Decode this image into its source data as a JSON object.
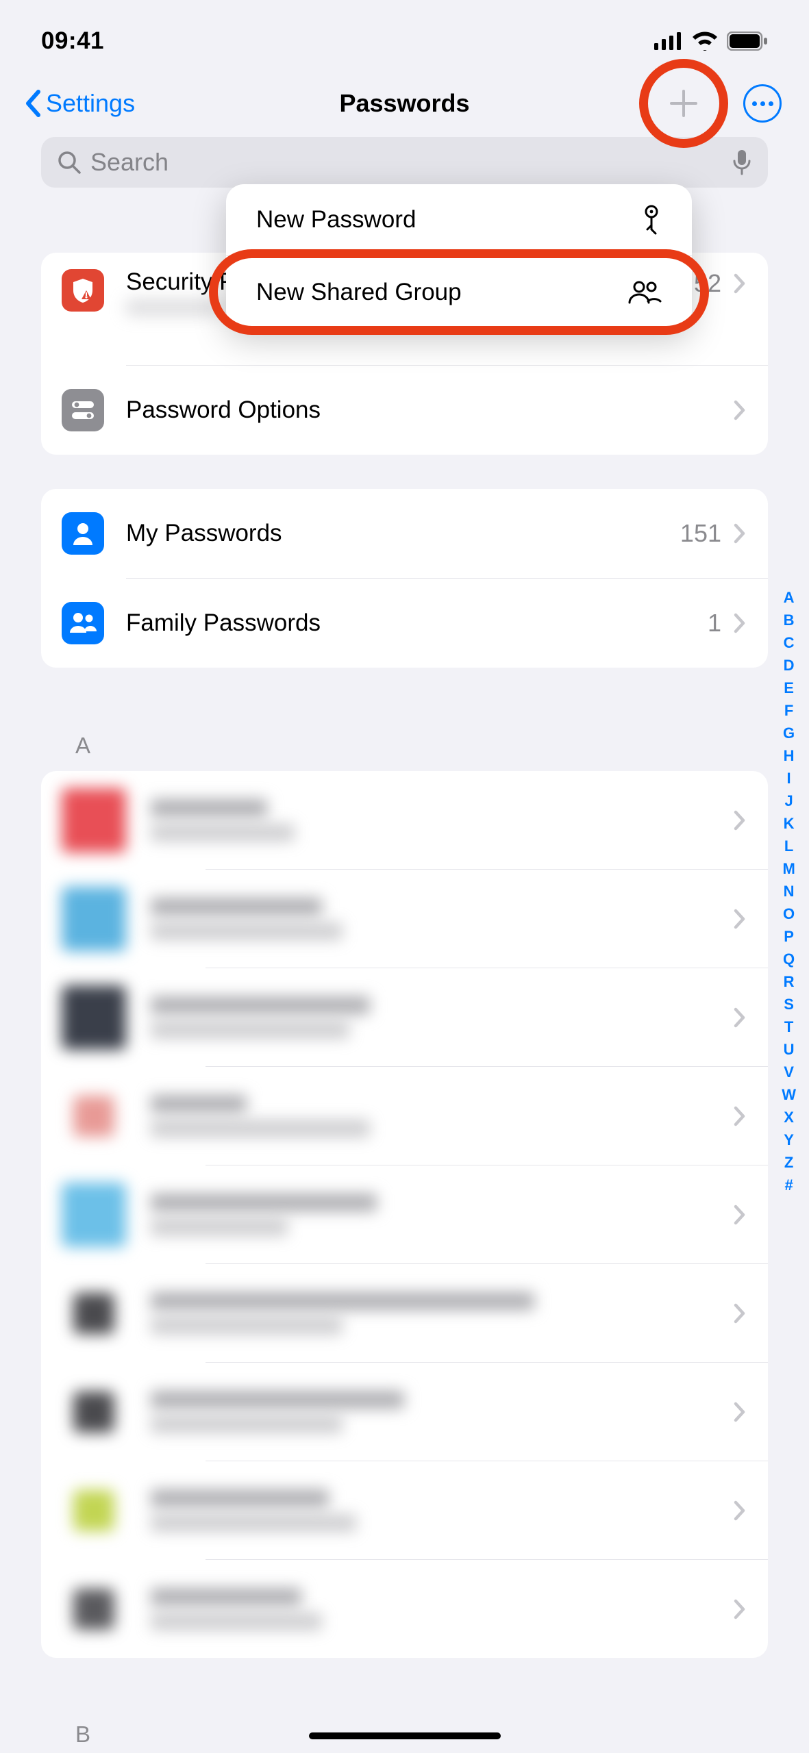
{
  "status": {
    "time": "09:41"
  },
  "nav": {
    "back": "Settings",
    "title": "Passwords"
  },
  "search": {
    "placeholder": "Search"
  },
  "popup": {
    "item1": "New Password",
    "item2": "New Shared Group"
  },
  "section1": {
    "security": {
      "title": "Security Recommendations",
      "count": "52"
    },
    "options": {
      "title": "Password Options"
    }
  },
  "section2": {
    "my": {
      "title": "My Passwords",
      "count": "151"
    },
    "family": {
      "title": "Family Passwords",
      "count": "1"
    }
  },
  "list": {
    "headerA": "A",
    "headerB": "B"
  },
  "alpha": [
    "A",
    "B",
    "C",
    "D",
    "E",
    "F",
    "G",
    "H",
    "I",
    "J",
    "K",
    "L",
    "M",
    "N",
    "O",
    "P",
    "Q",
    "R",
    "S",
    "T",
    "U",
    "V",
    "W",
    "X",
    "Y",
    "Z",
    "#"
  ]
}
